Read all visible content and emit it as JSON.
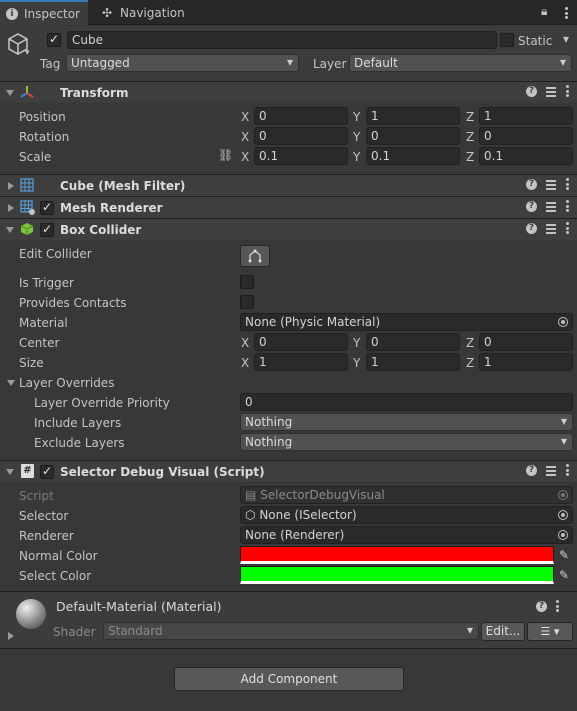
{
  "tabs": [
    {
      "label": "Inspector",
      "icon": "info-icon"
    },
    {
      "label": "Navigation",
      "icon": "navigation-icon"
    }
  ],
  "object": {
    "name": "Cube",
    "active": true,
    "static_label": "Static",
    "tag_label": "Tag",
    "tag_value": "Untagged",
    "layer_label": "Layer",
    "layer_value": "Default"
  },
  "transform": {
    "title": "Transform",
    "rows": [
      {
        "label": "Position",
        "x": "0",
        "y": "1",
        "z": "1"
      },
      {
        "label": "Rotation",
        "x": "0",
        "y": "0",
        "z": "0"
      },
      {
        "label": "Scale",
        "x": "0.1",
        "y": "0.1",
        "z": "0.1"
      }
    ]
  },
  "axis": {
    "x": "X",
    "y": "Y",
    "z": "Z"
  },
  "mesh_filter": {
    "title": "Cube (Mesh Filter)"
  },
  "mesh_renderer": {
    "title": "Mesh Renderer",
    "enabled": true
  },
  "box_collider": {
    "title": "Box Collider",
    "enabled": true,
    "edit_collider_label": "Edit Collider",
    "is_trigger_label": "Is Trigger",
    "provides_contacts_label": "Provides Contacts",
    "material_label": "Material",
    "material_value": "None (Physic Material)",
    "center": {
      "label": "Center",
      "x": "0",
      "y": "0",
      "z": "0"
    },
    "size": {
      "label": "Size",
      "x": "1",
      "y": "1",
      "z": "1"
    },
    "layer_overrides_label": "Layer Overrides",
    "priority_label": "Layer Override Priority",
    "priority_value": "0",
    "include_label": "Include Layers",
    "include_value": "Nothing",
    "exclude_label": "Exclude Layers",
    "exclude_value": "Nothing"
  },
  "selector_debug": {
    "title": "Selector Debug Visual (Script)",
    "enabled": true,
    "script_label": "Script",
    "script_value": "SelectorDebugVisual",
    "selector_label": "Selector",
    "selector_value": "None (ISelector)",
    "renderer_label": "Renderer",
    "renderer_value": "None (Renderer)",
    "normal_color_label": "Normal Color",
    "normal_color": "#ff0000",
    "select_color_label": "Select Color",
    "select_color": "#00ff00"
  },
  "material": {
    "name": "Default-Material (Material)",
    "shader_label": "Shader",
    "shader_value": "Standard",
    "edit_label": "Edit..."
  },
  "add_component_label": "Add Component",
  "colors": {
    "accent": "#3a79bb",
    "panel": "#383838",
    "header": "#3e3e3e"
  }
}
